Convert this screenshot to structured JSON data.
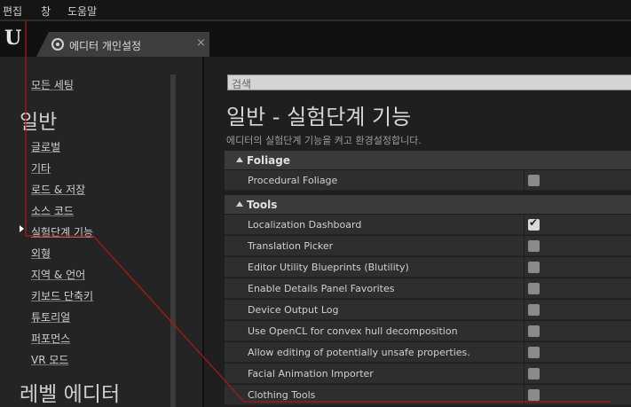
{
  "menu": {
    "edit": "편집",
    "window": "창",
    "help": "도움말"
  },
  "tab": {
    "title": "에디터 개인설정",
    "close": "×"
  },
  "logo": {
    "glyph": "U"
  },
  "sidebar": {
    "top_link": "모든 세팅",
    "heading_general": "일반",
    "items": [
      {
        "label": "글로벌"
      },
      {
        "label": "기타"
      },
      {
        "label": "로드 & 저장"
      },
      {
        "label": "소스 코드"
      },
      {
        "label": "실험단계 기능",
        "selected": true
      },
      {
        "label": "외형"
      },
      {
        "label": "지역 & 언어"
      },
      {
        "label": "키보드 단축키"
      },
      {
        "label": "튜토리얼"
      },
      {
        "label": "퍼포먼스"
      },
      {
        "label": "VR 모드"
      }
    ],
    "heading_level_editor": "레벨 에디터"
  },
  "search": {
    "placeholder": "검색"
  },
  "main": {
    "title": "일반 - 실험단계 기능",
    "subtitle": "에디터의 실험단계 기능을 켜고 환경설정합니다."
  },
  "categories": [
    {
      "name": "Foliage",
      "rows": [
        {
          "label": "Procedural Foliage",
          "checked": false
        }
      ]
    },
    {
      "name": "Tools",
      "rows": [
        {
          "label": "Localization Dashboard",
          "checked": true
        },
        {
          "label": "Translation Picker",
          "checked": false
        },
        {
          "label": "Editor Utility Blueprints (Blutility)",
          "checked": false
        },
        {
          "label": "Enable Details Panel Favorites",
          "checked": false
        },
        {
          "label": "Device Output Log",
          "checked": false
        },
        {
          "label": "Use OpenCL for convex hull decomposition",
          "checked": false
        },
        {
          "label": "Allow editing of potentially unsafe properties.",
          "checked": false
        },
        {
          "label": "Facial Animation Importer",
          "checked": false
        },
        {
          "label": "Clothing Tools",
          "checked": false
        }
      ]
    }
  ],
  "colors": {
    "annotation_line": "#b01818",
    "checkbox_on": "#d8d8d8",
    "checkbox_off": "#8a8a8a"
  }
}
